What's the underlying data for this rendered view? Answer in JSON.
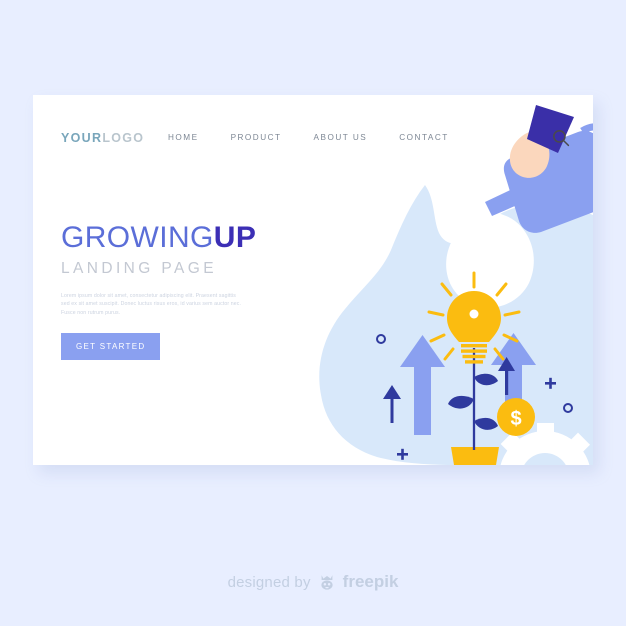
{
  "page": {
    "background_color": "#e8eeff",
    "card_background": "#ffffff"
  },
  "header": {
    "logo": {
      "part_one": "YOUR",
      "part_two": "LOGO",
      "part_one_color": "#79a6bb",
      "part_two_color": "#b9c5cd"
    },
    "nav": [
      {
        "label": "HOME"
      },
      {
        "label": "PRODUCT"
      },
      {
        "label": "ABOUT US"
      },
      {
        "label": "CONTACT"
      }
    ],
    "search_icon": "search-icon"
  },
  "hero": {
    "headline_regular": "GROWING",
    "headline_bold": "UP",
    "subheadline": "LANDING PAGE",
    "body": "Lorem ipsum dolor sit amet, consectetur adipiscing elit. Praesent sagittis sed ex sit amet suscipit. Donec luctus risus eros, id varius sem auctor nec. Fusce non rutrum purus.",
    "cta_label": "GET STARTED",
    "cta_color": "#8aa0f0",
    "headline_color": "#5b6ed8",
    "headline_bold_color": "#3c2fb5",
    "subheadline_color": "#c3c8d2"
  },
  "illustration": {
    "blob_color": "#d6e7fa",
    "arrow_color": "#8aa0f0",
    "accent_navy": "#2f3a9e",
    "accent_yellow": "#fbbc10",
    "gear_color": "#ffffff",
    "skin_color": "#fbd7bd",
    "sleeve_color": "#3a2fa8",
    "coin_symbol": "$",
    "elements": [
      "watering-can",
      "hand",
      "light-bulb",
      "plant-stem",
      "flower-pot",
      "big-arrow-left",
      "big-arrow-right",
      "small-arrow-left",
      "gear",
      "gear-arrow",
      "dollar-coin",
      "plus-marks",
      "circle-marks"
    ]
  },
  "footer": {
    "designed_by": "designed by",
    "brand": "freepik",
    "text_color": "#c3cfe2"
  }
}
